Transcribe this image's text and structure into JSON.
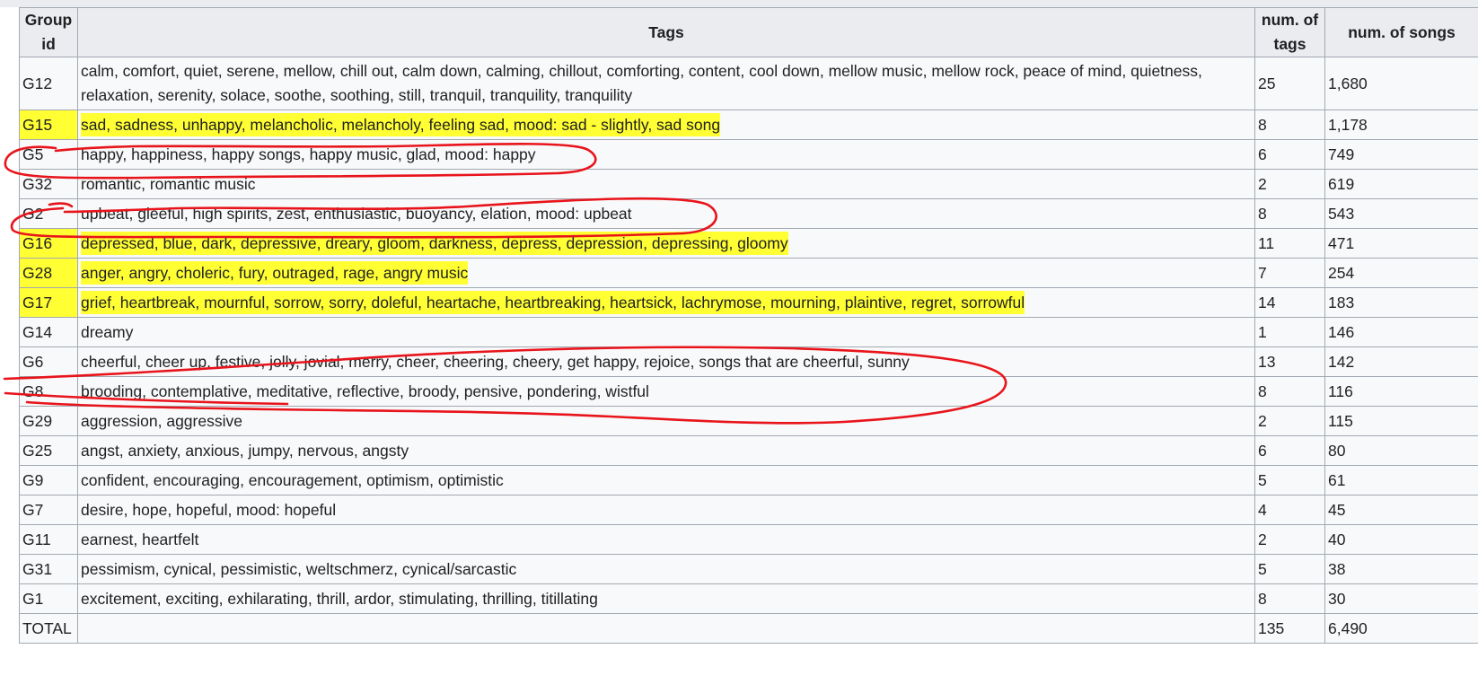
{
  "table": {
    "headers": {
      "group": "Group id",
      "tags": "Tags",
      "num_tags": "num. of tags",
      "num_songs": "num. of songs"
    },
    "rows": [
      {
        "group": "G12",
        "tags": "calm, comfort, quiet, serene, mellow, chill out, calm down, calming, chillout, comforting, content, cool down, mellow music, mellow rock, peace of mind, quietness, relaxation, serenity, solace, soothe, soothing, still, tranquil, tranquility, tranquility",
        "num_tags": "25",
        "num_songs": "1,680"
      },
      {
        "group": "G15",
        "tags": "sad, sadness, unhappy, melancholic, melancholy, feeling sad, mood: sad - slightly, sad song",
        "num_tags": "8",
        "num_songs": "1,178"
      },
      {
        "group": "G5",
        "tags": "happy, happiness, happy songs, happy music, glad, mood: happy",
        "num_tags": "6",
        "num_songs": "749"
      },
      {
        "group": "G32",
        "tags": "romantic, romantic music",
        "num_tags": "2",
        "num_songs": "619"
      },
      {
        "group": "G2",
        "tags": "upbeat, gleeful, high spirits, zest, enthusiastic, buoyancy, elation, mood: upbeat",
        "num_tags": "8",
        "num_songs": "543"
      },
      {
        "group": "G16",
        "tags": "depressed, blue, dark, depressive, dreary, gloom, darkness, depress, depression, depressing, gloomy",
        "num_tags": "11",
        "num_songs": "471"
      },
      {
        "group": "G28",
        "tags": "anger, angry, choleric, fury, outraged, rage, angry music",
        "num_tags": "7",
        "num_songs": "254"
      },
      {
        "group": "G17",
        "tags": "grief, heartbreak, mournful, sorrow, sorry, doleful, heartache, heartbreaking, heartsick, lachrymose, mourning, plaintive, regret, sorrowful",
        "num_tags": "14",
        "num_songs": "183"
      },
      {
        "group": "G14",
        "tags": "dreamy",
        "num_tags": "1",
        "num_songs": "146"
      },
      {
        "group": "G6",
        "tags": "cheerful, cheer up, festive, jolly, jovial, merry, cheer, cheering, cheery, get happy, rejoice, songs that are cheerful, sunny",
        "num_tags": "13",
        "num_songs": "142"
      },
      {
        "group": "G8",
        "tags": "brooding, contemplative, meditative, reflective, broody, pensive, pondering, wistful",
        "num_tags": "8",
        "num_songs": "116"
      },
      {
        "group": "G29",
        "tags": "aggression, aggressive",
        "num_tags": "2",
        "num_songs": "115"
      },
      {
        "group": "G25",
        "tags": "angst, anxiety, anxious, jumpy, nervous, angsty",
        "num_tags": "6",
        "num_songs": "80"
      },
      {
        "group": "G9",
        "tags": "confident, encouraging, encouragement, optimism, optimistic",
        "num_tags": "5",
        "num_songs": "61"
      },
      {
        "group": "G7",
        "tags": "desire, hope, hopeful, mood: hopeful",
        "num_tags": "4",
        "num_songs": "45"
      },
      {
        "group": "G11",
        "tags": "earnest, heartfelt",
        "num_tags": "2",
        "num_songs": "40"
      },
      {
        "group": "G31",
        "tags": "pessimism, cynical, pessimistic, weltschmerz, cynical/sarcastic",
        "num_tags": "5",
        "num_songs": "38"
      },
      {
        "group": "G1",
        "tags": "excitement, exciting, exhilarating, thrill, ardor, stimulating, thrilling, titillating",
        "num_tags": "8",
        "num_songs": "30"
      }
    ],
    "total": {
      "label": "TOTAL",
      "tags": "",
      "num_tags": "135",
      "num_songs": "6,490"
    }
  },
  "annotations": {
    "highlight_color": "#ffff33",
    "ink_color": "#e8141b"
  }
}
